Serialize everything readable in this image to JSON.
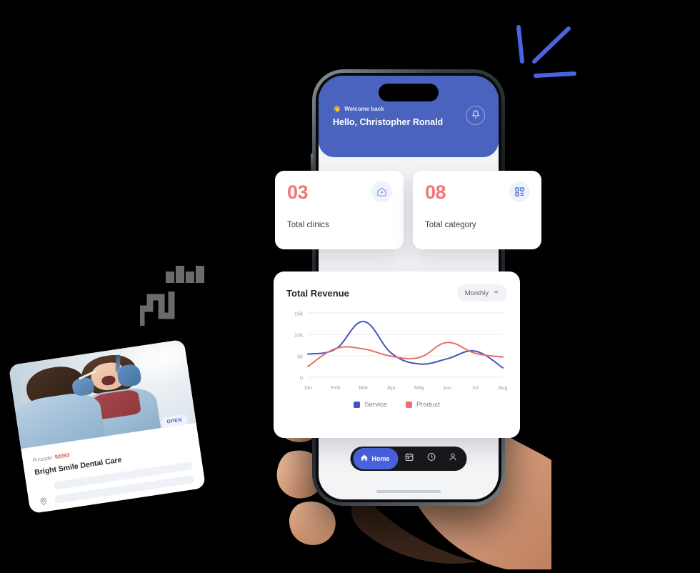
{
  "app": {
    "header": {
      "wave_icon": "waving-hand-icon",
      "welcome_text": "Welcome back",
      "greeting": "Hello, Christopher Ronald",
      "notification_icon": "bell-icon",
      "background_color": "#4a63be"
    },
    "stats": [
      {
        "value": "03",
        "label": "Total clinics",
        "icon": "clinic-house-icon",
        "value_color": "#ef7777"
      },
      {
        "value": "08",
        "label": "Total category",
        "icon": "grid-category-icon",
        "value_color": "#ef7777"
      }
    ],
    "revenue": {
      "title": "Total Revenue",
      "period_label": "Monthly",
      "period_icon": "chevron-down-icon"
    },
    "bottom_nav": {
      "items": [
        {
          "label": "Home",
          "icon": "home-icon",
          "active": true
        },
        {
          "label": "",
          "icon": "calendar-icon",
          "active": false
        },
        {
          "label": "",
          "icon": "history-clock-icon",
          "active": false
        },
        {
          "label": "",
          "icon": "person-icon",
          "active": false
        }
      ],
      "active_color": "#4a63e0"
    }
  },
  "chart_data": {
    "type": "line",
    "title": "Total Revenue",
    "xlabel": "",
    "ylabel": "",
    "ylim": [
      0,
      15000
    ],
    "yticks": [
      0,
      5000,
      10000,
      15000
    ],
    "ytick_labels": [
      "0",
      "5k",
      "10k",
      "15k"
    ],
    "categories": [
      "Jan",
      "Feb",
      "Mar",
      "Apr",
      "May",
      "Jun",
      "Jul",
      "Aug"
    ],
    "grid": true,
    "legend_position": "bottom-center",
    "series": [
      {
        "name": "Service",
        "color": "#3f56c0",
        "values": [
          5400,
          6600,
          13000,
          5600,
          3100,
          4300,
          6100,
          2200
        ]
      },
      {
        "name": "Product",
        "color": "#e8706e",
        "values": [
          2500,
          6700,
          6600,
          4900,
          4600,
          8100,
          5600,
          4700
        ]
      }
    ]
  },
  "clinic_card": {
    "status_badge": "OPEN",
    "pincode_label": "Pincode:",
    "pincode_value": "92093",
    "name": "Bright Smile Dental Care",
    "location_icon": "location-pin-icon",
    "phone_icon": "phone-icon",
    "photo_alt": "dentist-examining-patient-photo"
  },
  "decorations": {
    "chart_lines_icon": "growth-chart-line-art-icon",
    "bars_icon": "bar-chart-glyph-icon",
    "zigzag_icon": "zigzag-line-glyph-icon",
    "accent_color": "#4a63e0"
  }
}
